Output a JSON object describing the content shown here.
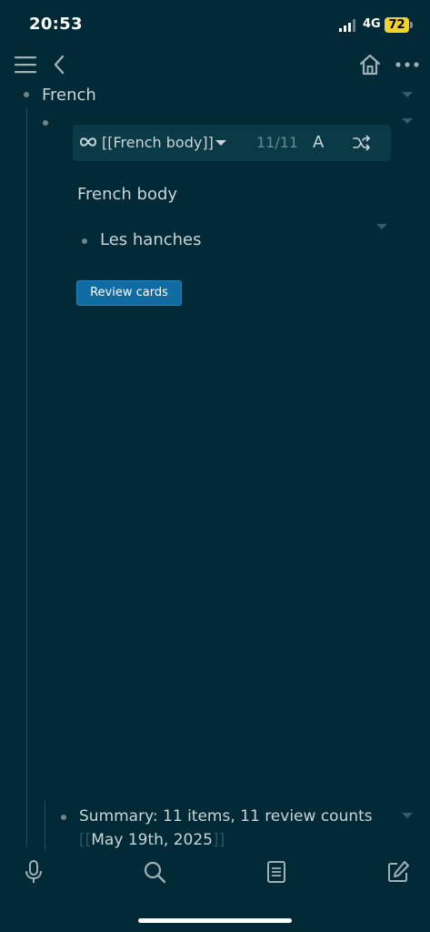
{
  "status": {
    "time": "20:53",
    "network": "4G",
    "battery": "72"
  },
  "nav": {
    "menu_icon": "hamburger-icon",
    "back_icon": "chevron-left-icon",
    "home_icon": "home-icon",
    "more_icon": "more-horizontal-icon"
  },
  "tree": {
    "parent": "French",
    "toolbar": {
      "link_text": "[[French body]]",
      "count": "11/11",
      "font_glyph": "A"
    },
    "block_title": "French body",
    "child_item": "Les hanches",
    "review_button": "Review cards",
    "summary": "Summary: 11 items, 11 review counts",
    "date_open": "[[",
    "date": "May 19th, 2025",
    "date_close": "]]"
  },
  "bottom_bar": {
    "icons": [
      "microphone-icon",
      "search-icon",
      "document-icon",
      "edit-icon"
    ]
  },
  "colors": {
    "background": "#022a36",
    "toolbar_bg": "#0b3a47",
    "button_blue": "#106ba3",
    "battery": "#f3d22a"
  }
}
